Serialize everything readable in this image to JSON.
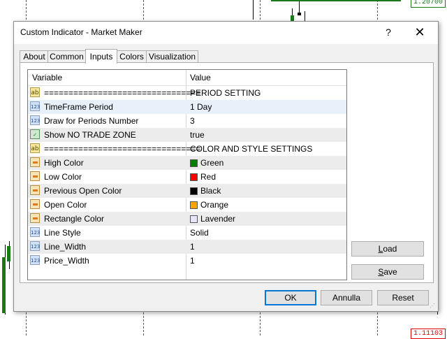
{
  "chart": {
    "price_top": "1.20700",
    "price_bottom": "1.11103"
  },
  "dialog": {
    "title": "Custom Indicator - Market Maker",
    "help_label": "?",
    "close_label": "✕"
  },
  "tabs": [
    {
      "label": "About"
    },
    {
      "label": "Common"
    },
    {
      "label": "Inputs"
    },
    {
      "label": "Colors"
    },
    {
      "label": "Visualization"
    }
  ],
  "active_tab": "Inputs",
  "grid": {
    "headers": {
      "variable": "Variable",
      "value": "Value"
    },
    "rows": [
      {
        "icon": "ab",
        "variable": "================================",
        "value": "PERIOD SETTING"
      },
      {
        "icon": "123",
        "variable": "TimeFrame Period",
        "value": "1 Day"
      },
      {
        "icon": "123",
        "variable": "Draw for Periods Number",
        "value": "3"
      },
      {
        "icon": "bool",
        "variable": "Show NO TRADE ZONE",
        "value": "true"
      },
      {
        "icon": "ab",
        "variable": "================================",
        "value": "COLOR AND STYLE SETTINGS"
      },
      {
        "icon": "color",
        "variable": "High Color",
        "value": "Green",
        "swatch": "#008000"
      },
      {
        "icon": "color",
        "variable": "Low Color",
        "value": "Red",
        "swatch": "#ff0000"
      },
      {
        "icon": "color",
        "variable": "Previous Open Color",
        "value": "Black",
        "swatch": "#000000"
      },
      {
        "icon": "color",
        "variable": "Open Color",
        "value": "Orange",
        "swatch": "#ffa500"
      },
      {
        "icon": "color",
        "variable": "Rectangle Color",
        "value": "Lavender",
        "swatch": "#e6e6fa"
      },
      {
        "icon": "123",
        "variable": "Line Style",
        "value": "Solid"
      },
      {
        "icon": "123",
        "variable": "Line_Width",
        "value": "1"
      },
      {
        "icon": "123",
        "variable": "Price_Width",
        "value": "1"
      }
    ]
  },
  "side_buttons": {
    "load_first": "L",
    "load_rest": "oad",
    "save_first": "S",
    "save_rest": "ave"
  },
  "footer": {
    "ok": "OK",
    "cancel": "Annulla",
    "reset": "Reset"
  }
}
